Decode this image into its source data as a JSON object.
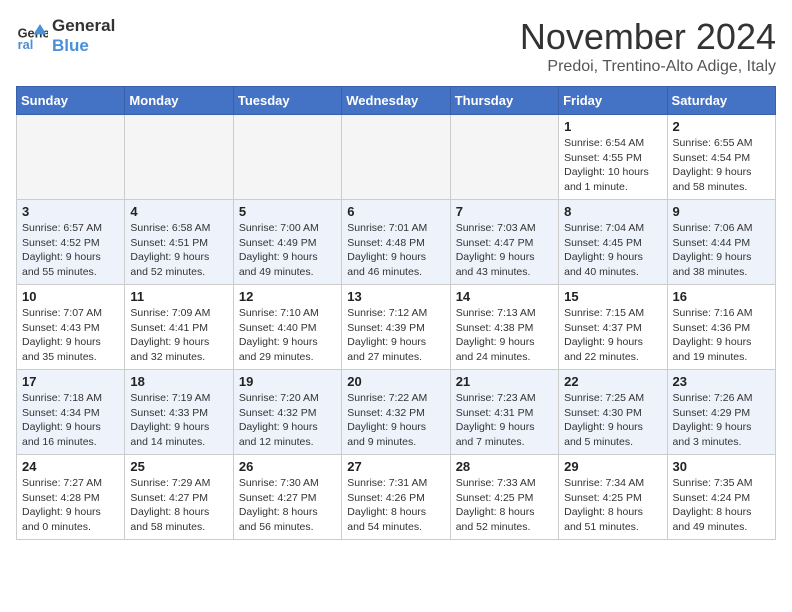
{
  "header": {
    "logo_line1": "General",
    "logo_line2": "Blue",
    "month_title": "November 2024",
    "location": "Predoi, Trentino-Alto Adige, Italy"
  },
  "calendar": {
    "weekdays": [
      "Sunday",
      "Monday",
      "Tuesday",
      "Wednesday",
      "Thursday",
      "Friday",
      "Saturday"
    ],
    "weeks": [
      [
        {
          "day": "",
          "info": ""
        },
        {
          "day": "",
          "info": ""
        },
        {
          "day": "",
          "info": ""
        },
        {
          "day": "",
          "info": ""
        },
        {
          "day": "",
          "info": ""
        },
        {
          "day": "1",
          "info": "Sunrise: 6:54 AM\nSunset: 4:55 PM\nDaylight: 10 hours and 1 minute."
        },
        {
          "day": "2",
          "info": "Sunrise: 6:55 AM\nSunset: 4:54 PM\nDaylight: 9 hours and 58 minutes."
        }
      ],
      [
        {
          "day": "3",
          "info": "Sunrise: 6:57 AM\nSunset: 4:52 PM\nDaylight: 9 hours and 55 minutes."
        },
        {
          "day": "4",
          "info": "Sunrise: 6:58 AM\nSunset: 4:51 PM\nDaylight: 9 hours and 52 minutes."
        },
        {
          "day": "5",
          "info": "Sunrise: 7:00 AM\nSunset: 4:49 PM\nDaylight: 9 hours and 49 minutes."
        },
        {
          "day": "6",
          "info": "Sunrise: 7:01 AM\nSunset: 4:48 PM\nDaylight: 9 hours and 46 minutes."
        },
        {
          "day": "7",
          "info": "Sunrise: 7:03 AM\nSunset: 4:47 PM\nDaylight: 9 hours and 43 minutes."
        },
        {
          "day": "8",
          "info": "Sunrise: 7:04 AM\nSunset: 4:45 PM\nDaylight: 9 hours and 40 minutes."
        },
        {
          "day": "9",
          "info": "Sunrise: 7:06 AM\nSunset: 4:44 PM\nDaylight: 9 hours and 38 minutes."
        }
      ],
      [
        {
          "day": "10",
          "info": "Sunrise: 7:07 AM\nSunset: 4:43 PM\nDaylight: 9 hours and 35 minutes."
        },
        {
          "day": "11",
          "info": "Sunrise: 7:09 AM\nSunset: 4:41 PM\nDaylight: 9 hours and 32 minutes."
        },
        {
          "day": "12",
          "info": "Sunrise: 7:10 AM\nSunset: 4:40 PM\nDaylight: 9 hours and 29 minutes."
        },
        {
          "day": "13",
          "info": "Sunrise: 7:12 AM\nSunset: 4:39 PM\nDaylight: 9 hours and 27 minutes."
        },
        {
          "day": "14",
          "info": "Sunrise: 7:13 AM\nSunset: 4:38 PM\nDaylight: 9 hours and 24 minutes."
        },
        {
          "day": "15",
          "info": "Sunrise: 7:15 AM\nSunset: 4:37 PM\nDaylight: 9 hours and 22 minutes."
        },
        {
          "day": "16",
          "info": "Sunrise: 7:16 AM\nSunset: 4:36 PM\nDaylight: 9 hours and 19 minutes."
        }
      ],
      [
        {
          "day": "17",
          "info": "Sunrise: 7:18 AM\nSunset: 4:34 PM\nDaylight: 9 hours and 16 minutes."
        },
        {
          "day": "18",
          "info": "Sunrise: 7:19 AM\nSunset: 4:33 PM\nDaylight: 9 hours and 14 minutes."
        },
        {
          "day": "19",
          "info": "Sunrise: 7:20 AM\nSunset: 4:32 PM\nDaylight: 9 hours and 12 minutes."
        },
        {
          "day": "20",
          "info": "Sunrise: 7:22 AM\nSunset: 4:32 PM\nDaylight: 9 hours and 9 minutes."
        },
        {
          "day": "21",
          "info": "Sunrise: 7:23 AM\nSunset: 4:31 PM\nDaylight: 9 hours and 7 minutes."
        },
        {
          "day": "22",
          "info": "Sunrise: 7:25 AM\nSunset: 4:30 PM\nDaylight: 9 hours and 5 minutes."
        },
        {
          "day": "23",
          "info": "Sunrise: 7:26 AM\nSunset: 4:29 PM\nDaylight: 9 hours and 3 minutes."
        }
      ],
      [
        {
          "day": "24",
          "info": "Sunrise: 7:27 AM\nSunset: 4:28 PM\nDaylight: 9 hours and 0 minutes."
        },
        {
          "day": "25",
          "info": "Sunrise: 7:29 AM\nSunset: 4:27 PM\nDaylight: 8 hours and 58 minutes."
        },
        {
          "day": "26",
          "info": "Sunrise: 7:30 AM\nSunset: 4:27 PM\nDaylight: 8 hours and 56 minutes."
        },
        {
          "day": "27",
          "info": "Sunrise: 7:31 AM\nSunset: 4:26 PM\nDaylight: 8 hours and 54 minutes."
        },
        {
          "day": "28",
          "info": "Sunrise: 7:33 AM\nSunset: 4:25 PM\nDaylight: 8 hours and 52 minutes."
        },
        {
          "day": "29",
          "info": "Sunrise: 7:34 AM\nSunset: 4:25 PM\nDaylight: 8 hours and 51 minutes."
        },
        {
          "day": "30",
          "info": "Sunrise: 7:35 AM\nSunset: 4:24 PM\nDaylight: 8 hours and 49 minutes."
        }
      ]
    ]
  }
}
